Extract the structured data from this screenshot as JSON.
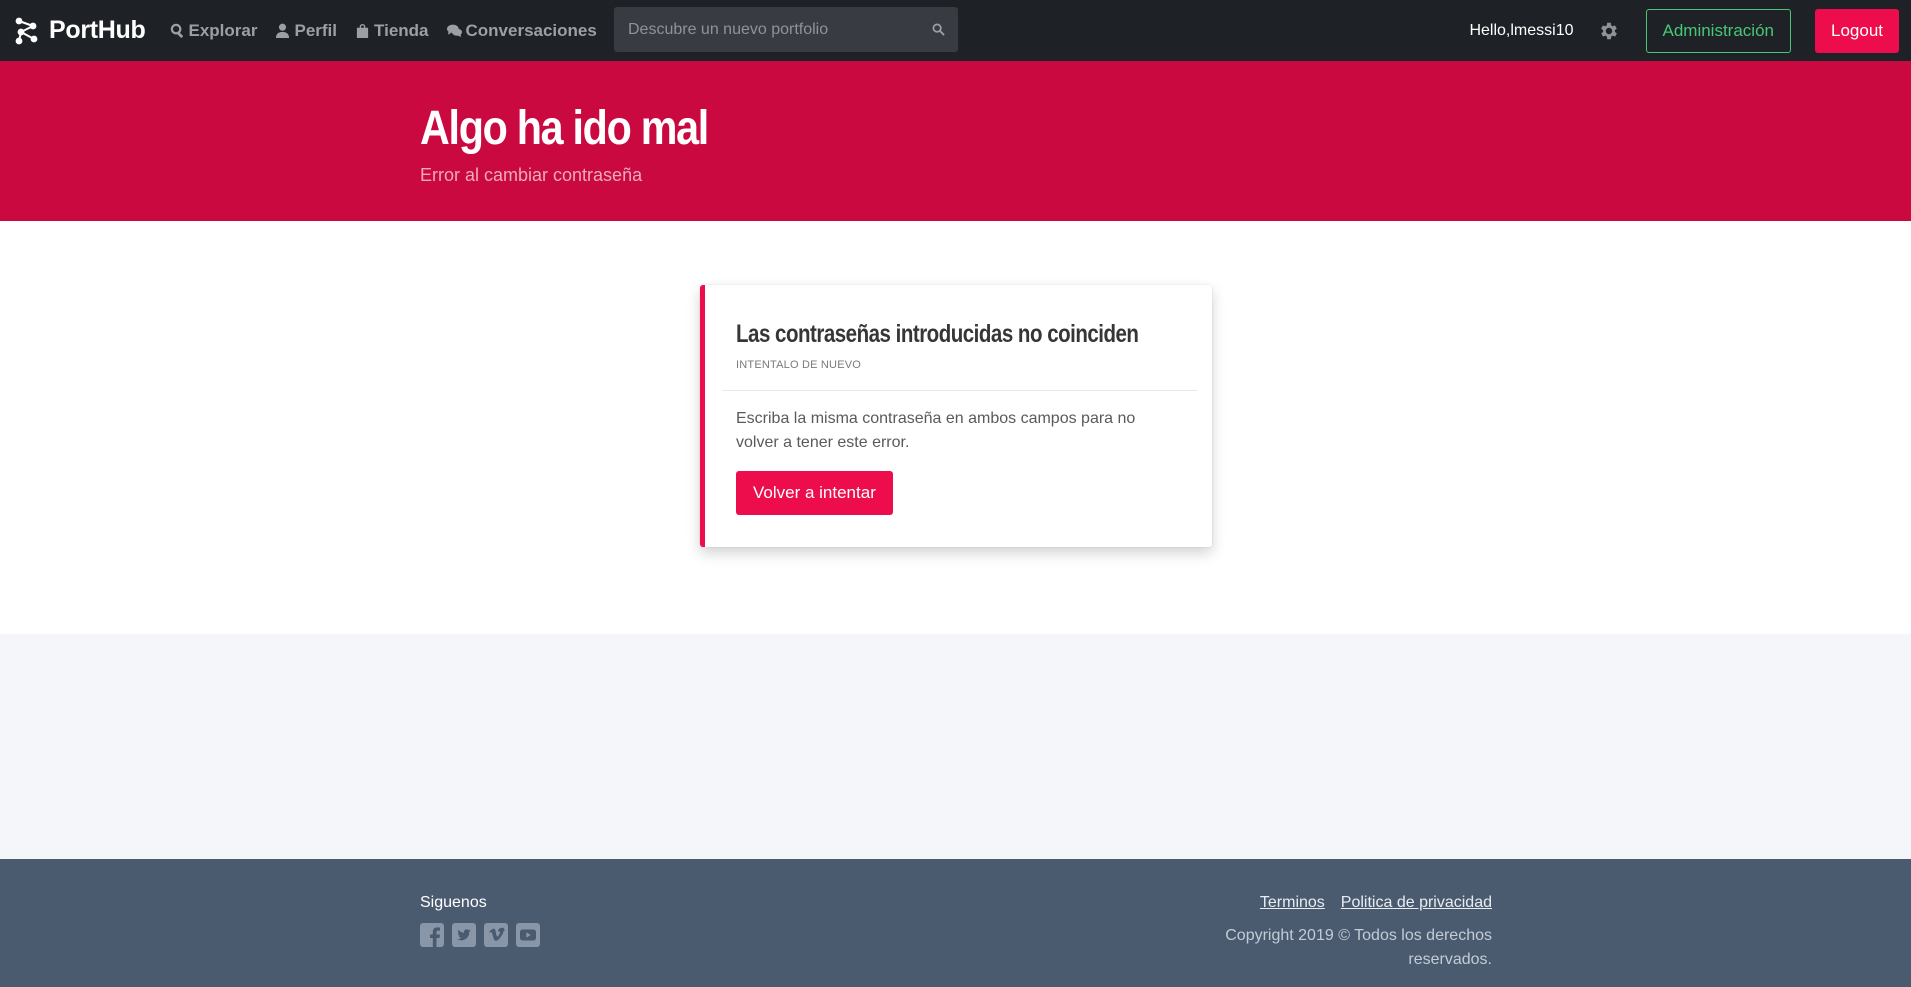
{
  "nav": {
    "brand": "PortHub",
    "links": [
      {
        "label": "Explorar",
        "icon": "search-icon"
      },
      {
        "label": "Perfil",
        "icon": "user-icon"
      },
      {
        "label": "Tienda",
        "icon": "shopping-bag-icon"
      },
      {
        "label": "Conversaciones",
        "icon": "comments-icon"
      }
    ],
    "search_placeholder": "Descubre un nuevo portfolio",
    "search_value": "",
    "greeting": "Hello,lmessi10",
    "admin_label": "Administración",
    "logout_label": "Logout"
  },
  "hero": {
    "title": "Algo ha ido mal",
    "subtitle": "Error al cambiar contraseña"
  },
  "card": {
    "title": "Las contraseñas introducidas no coinciden",
    "subtitle": "INTENTALO DE NUEVO",
    "message": "Escriba la misma contraseña en ambos campos para no volver a tener este error.",
    "button_label": "Volver a intentar"
  },
  "footer": {
    "follow_label": "Siguenos",
    "socials": [
      "facebook-icon",
      "twitter-icon",
      "vimeo-icon",
      "youtube-icon"
    ],
    "links": [
      "Terminos",
      "Politica de privacidad"
    ],
    "copyright": "Copyright 2019 © Todos los derechos reservados."
  },
  "colors": {
    "navbar": "#1e2125",
    "hero": "#c90940",
    "accent": "#ed0d4c",
    "admin": "#48c774",
    "footer": "#4a5b70"
  }
}
